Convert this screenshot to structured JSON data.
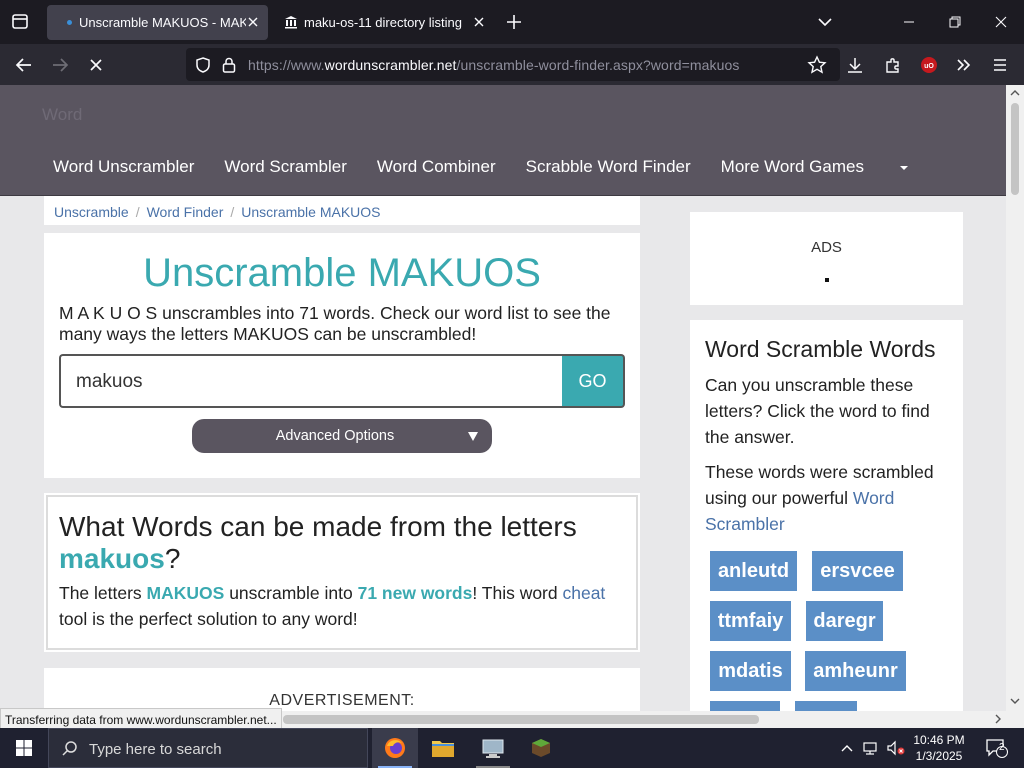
{
  "browser": {
    "tabs": [
      {
        "title": "Unscramble MAKUOS - MAKUOS",
        "active": true
      },
      {
        "title": "maku-os-11 directory listing",
        "active": false
      }
    ],
    "url_prefix": "https://www.",
    "url_host": "wordunscrambler.net",
    "url_path": "/unscramble-word-finder.aspx?word=makuos",
    "status_text": "Transferring data from www.wordunscrambler.net..."
  },
  "site": {
    "brand": "Word",
    "menu": [
      "Word Unscrambler",
      "Word Scrambler",
      "Word Combiner",
      "Scrabble Word Finder",
      "More Word Games"
    ],
    "breadcrumb": [
      "Unscramble",
      "Word Finder",
      "Unscramble MAKUOS"
    ],
    "main": {
      "title": "Unscramble MAKUOS",
      "intro": "M A K U O S unscrambles into 71 words. Check our word list to see the many ways the letters MAKUOS can be unscrambled!",
      "search_value": "makuos",
      "go_label": "GO",
      "advanced_label": "Advanced Options"
    },
    "words_section": {
      "heading_prefix": "What Words can be made from the letters ",
      "heading_word": "makuos",
      "heading_suffix": "?",
      "desc_1": "The letters ",
      "desc_letters": "MAKUOS",
      "desc_2": " unscramble into ",
      "desc_count": "71 new words",
      "desc_3": "! This word ",
      "desc_link": "cheat",
      "desc_4": " tool is the perfect solution to any word!"
    },
    "advertisement_label": "ADVERTISEMENT:",
    "sidebar": {
      "ads_label": "ADS",
      "title": "Word Scramble Words",
      "p1": "Can you unscramble these letters? Click the word to find the answer.",
      "p2_text": "These words were scrambled using our powerful ",
      "p2_link": "Word Scrambler",
      "chips": [
        "anleutd",
        "ersvcee",
        "ttmfaiy",
        "daregr",
        "mdatis",
        "amheunr"
      ]
    }
  },
  "taskbar": {
    "search_placeholder": "Type here to search",
    "time": "10:46 PM",
    "date": "1/3/2025",
    "notification_count": "2"
  },
  "colors": {
    "accent_teal": "#3aa9b0",
    "header_bg": "#5a5560",
    "chip_blue": "#5b8fc7",
    "link_blue": "#4a72a8"
  }
}
